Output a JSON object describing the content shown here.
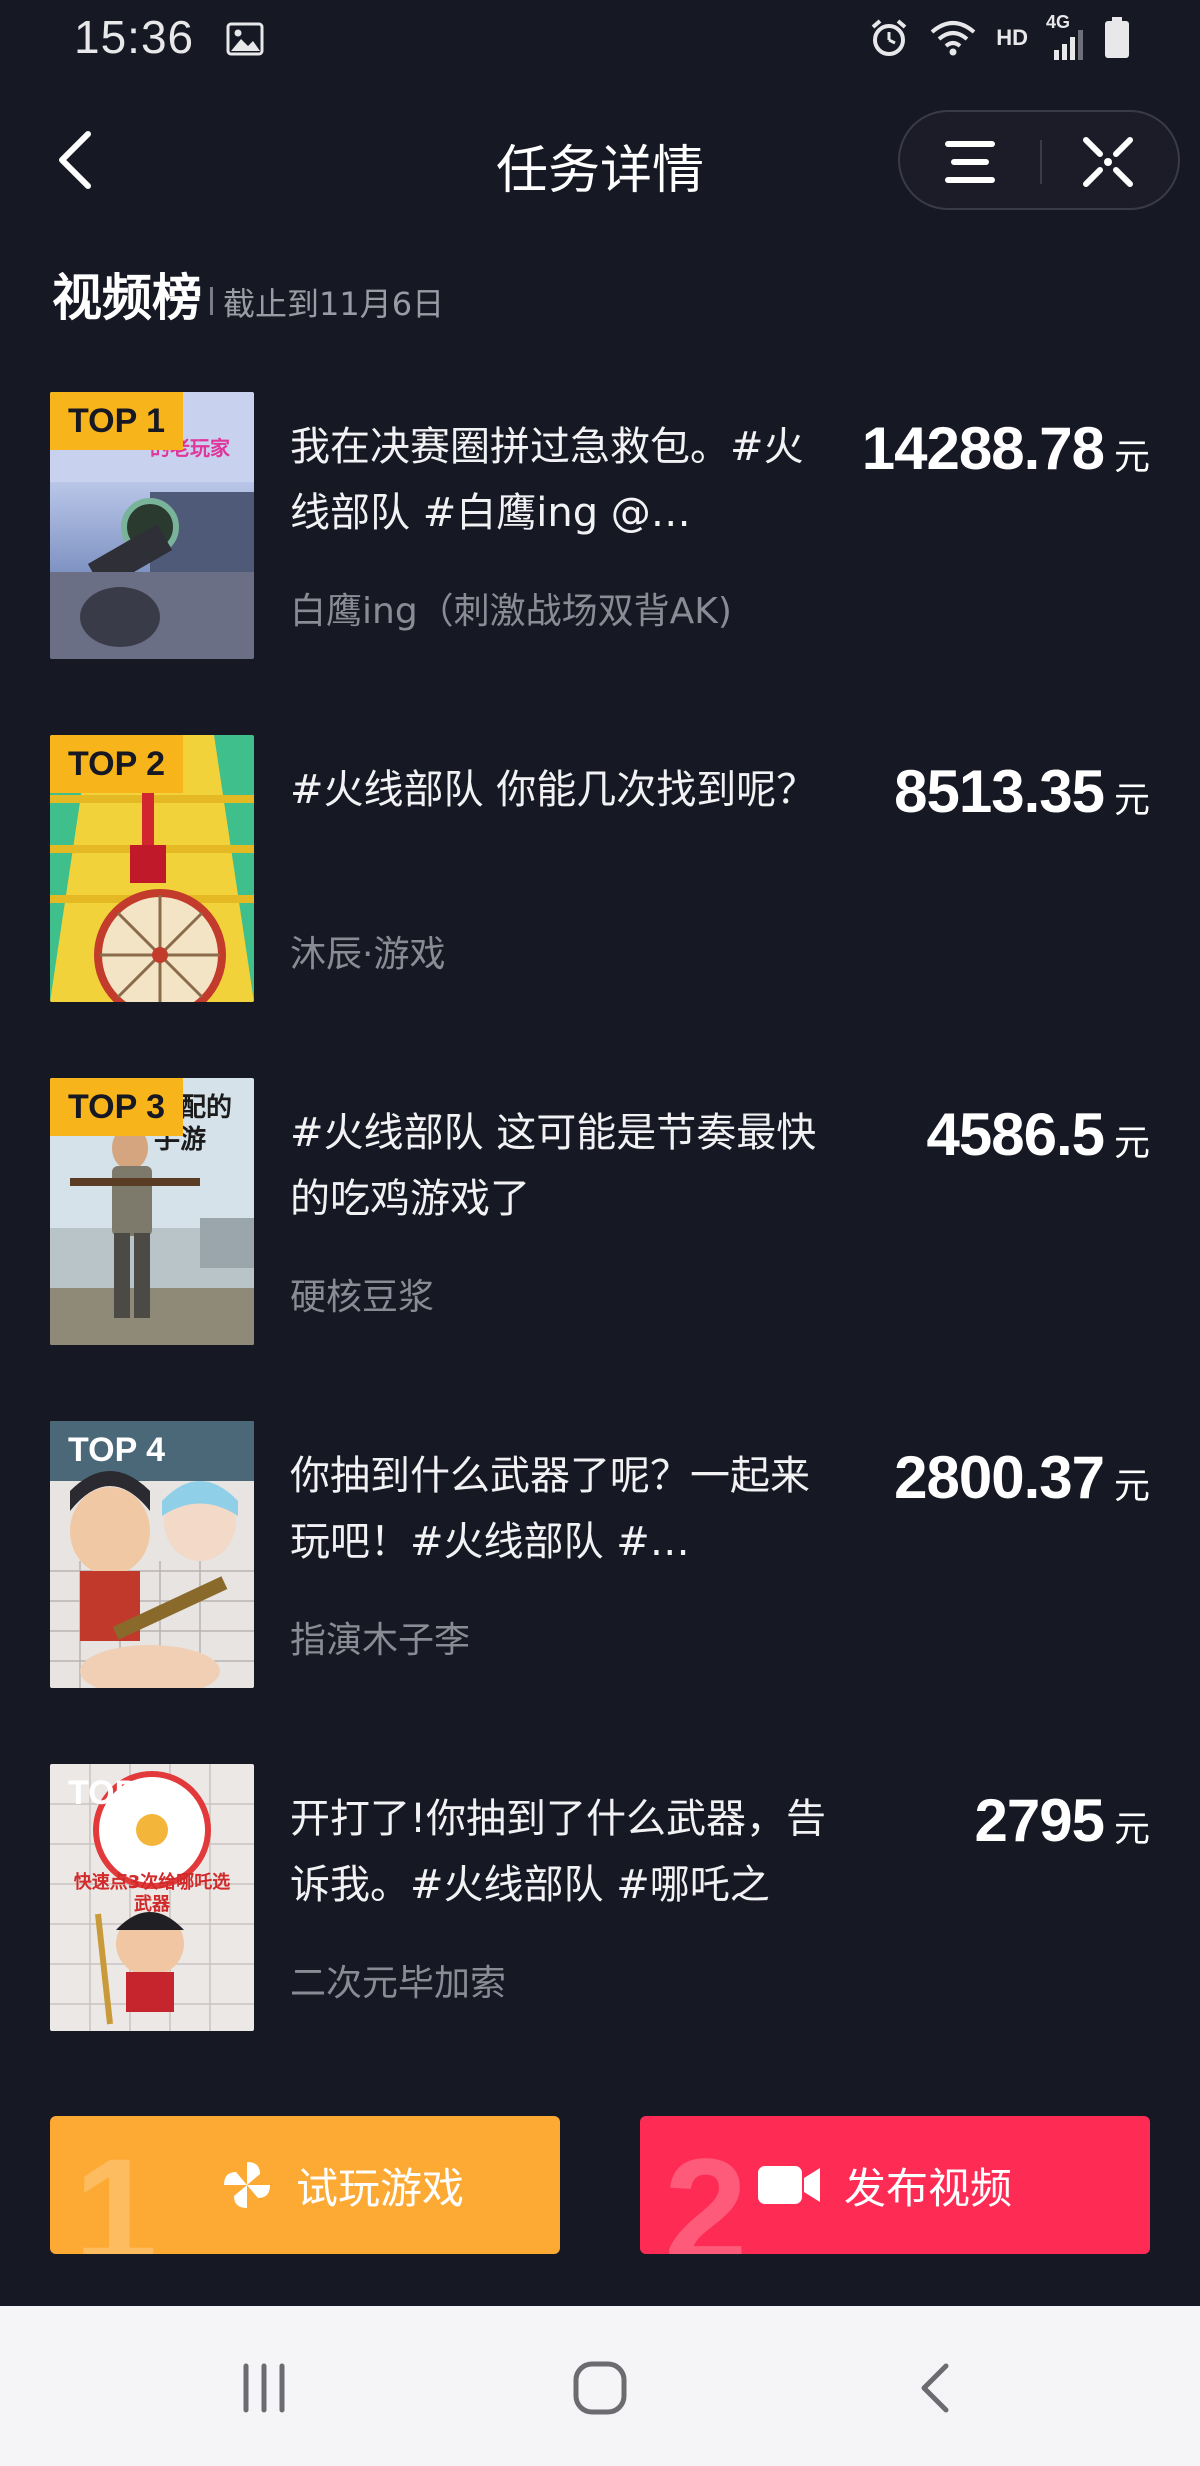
{
  "status_bar": {
    "time": "15:36",
    "network_hd": "HD",
    "network_type": "4G"
  },
  "nav": {
    "title": "任务详情"
  },
  "section": {
    "title": "视频榜",
    "date": "截止到11月6日"
  },
  "ranking": [
    {
      "badge": "TOP 1",
      "title": "我在决赛圈拼过急救包。#火线部队 #白鹰ing @…",
      "author": "白鹰ing（刺激战场双背AK)",
      "amount": "14288.78",
      "unit": "元",
      "thumb_caption": "的老玩家"
    },
    {
      "badge": "TOP 2",
      "title": "#火线部队 你能几次找到呢？",
      "author": "沐辰·游戏",
      "amount": "8513.35",
      "unit": "元",
      "thumb_caption": ""
    },
    {
      "badge": "TOP 3",
      "title": "#火线部队 这可能是节奏最快的吃鸡游戏了",
      "author": "硬核豆浆",
      "amount": "4586.5",
      "unit": "元",
      "thumb_caption": "低配的 手游"
    },
    {
      "badge": "TOP 4",
      "title": "你抽到什么武器了呢？一起来玩吧！#火线部队 #…",
      "author": "指演木子李",
      "amount": "2800.37",
      "unit": "元",
      "thumb_caption": ""
    },
    {
      "badge": "TOP 5",
      "title": "开打了!你抽到了什么武器，告诉我。#火线部队 #哪吒之魔…",
      "author": "二次元毕加索",
      "amount": "2795",
      "unit": "元",
      "thumb_caption": "快速点3次给哪吒选武器"
    }
  ],
  "actions": {
    "play": {
      "step": "1",
      "label": "试玩游戏"
    },
    "publish": {
      "step": "2",
      "label": "发布视频"
    }
  },
  "colors": {
    "background": "#161823",
    "badge": "#f8b41b",
    "play_button": "#fdaa34",
    "publish_button": "#fe2c55"
  }
}
